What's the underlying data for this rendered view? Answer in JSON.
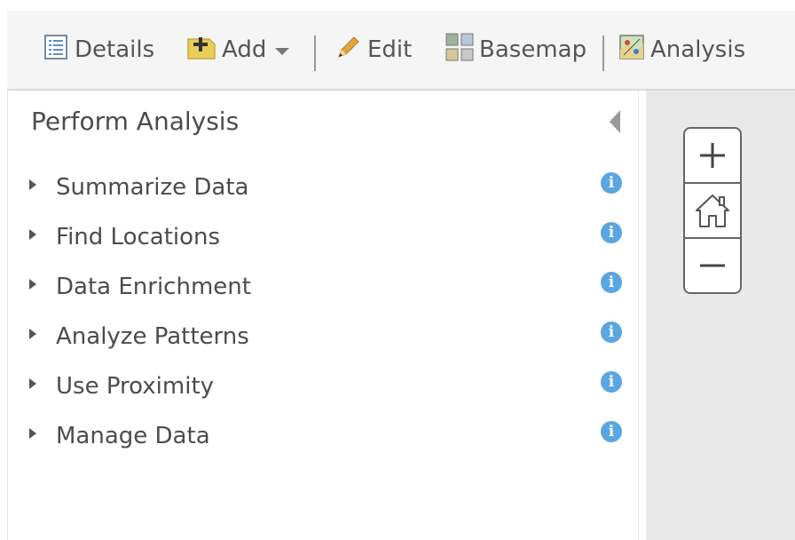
{
  "toolbar": {
    "details_label": "Details",
    "add_label": "Add",
    "edit_label": "Edit",
    "basemap_label": "Basemap",
    "analysis_label": "Analysis"
  },
  "panel": {
    "title": "Perform Analysis",
    "categories": [
      {
        "label": "Summarize Data"
      },
      {
        "label": "Find Locations"
      },
      {
        "label": "Data Enrichment"
      },
      {
        "label": "Analyze Patterns"
      },
      {
        "label": "Use Proximity"
      },
      {
        "label": "Manage Data"
      }
    ],
    "info_icon": "i"
  },
  "map": {
    "zoom_in_label": "+",
    "zoom_out_label": "−"
  },
  "colors": {
    "info_blue": "#5aa6e2",
    "toolbar_bg": "#f4f5f4",
    "map_bg": "#e9e9e9"
  }
}
